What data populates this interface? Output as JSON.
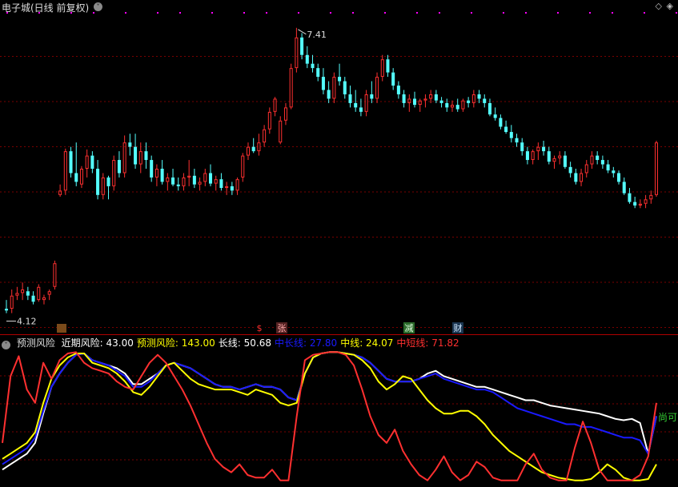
{
  "title": {
    "stock": "电子城(日线 前复权)"
  },
  "colors": {
    "bg": "#000000",
    "up": "#ff3030",
    "down": "#54ffff",
    "grid": "#7a0000",
    "sep": "#b00000",
    "magenta": "#ff00ff"
  },
  "chart_data": [
    {
      "type": "candlestick",
      "title": "电子城(日线 前复权)",
      "high_label": "7.41",
      "low_label": "4.12",
      "markers": [
        "$",
        "张",
        "减",
        "财"
      ],
      "candles": [
        [
          4.2,
          4.3,
          4.15,
          4.18
        ],
        [
          4.2,
          4.42,
          4.15,
          4.35
        ],
        [
          4.35,
          4.45,
          4.3,
          4.38
        ],
        [
          4.38,
          4.5,
          4.3,
          4.42
        ],
        [
          4.4,
          4.45,
          4.3,
          4.35
        ],
        [
          4.35,
          4.4,
          4.25,
          4.28
        ],
        [
          4.3,
          4.48,
          4.28,
          4.45
        ],
        [
          4.3,
          4.36,
          4.25,
          4.33
        ],
        [
          4.36,
          4.42,
          4.3,
          4.4
        ],
        [
          4.45,
          4.75,
          4.42,
          4.72
        ],
        [
          5.5,
          5.62,
          5.48,
          5.55
        ],
        [
          5.55,
          6.03,
          5.5,
          6.0
        ],
        [
          6.0,
          6.05,
          5.7,
          5.75
        ],
        [
          5.75,
          6.1,
          5.6,
          5.65
        ],
        [
          5.62,
          5.83,
          5.58,
          5.8
        ],
        [
          5.8,
          6.02,
          5.7,
          5.95
        ],
        [
          5.95,
          6.0,
          5.75,
          5.8
        ],
        [
          5.8,
          5.9,
          5.45,
          5.5
        ],
        [
          5.5,
          5.75,
          5.45,
          5.7
        ],
        [
          5.7,
          5.72,
          5.45,
          5.6
        ],
        [
          5.6,
          5.95,
          5.55,
          5.9
        ],
        [
          5.9,
          6.0,
          5.7,
          5.75
        ],
        [
          5.75,
          6.18,
          5.7,
          6.1
        ],
        [
          6.1,
          6.2,
          5.95,
          6.05
        ],
        [
          6.05,
          6.2,
          5.8,
          5.85
        ],
        [
          5.85,
          6.1,
          5.75,
          6.0
        ],
        [
          6.0,
          6.1,
          5.8,
          5.9
        ],
        [
          5.9,
          5.95,
          5.65,
          5.7
        ],
        [
          5.7,
          5.85,
          5.6,
          5.8
        ],
        [
          5.8,
          5.9,
          5.62,
          5.65
        ],
        [
          5.65,
          5.75,
          5.55,
          5.7
        ],
        [
          5.7,
          5.8,
          5.6,
          5.62
        ],
        [
          5.62,
          5.7,
          5.55,
          5.6
        ],
        [
          5.6,
          5.75,
          5.55,
          5.7
        ],
        [
          5.7,
          5.9,
          5.6,
          5.72
        ],
        [
          5.72,
          5.8,
          5.58,
          5.62
        ],
        [
          5.62,
          5.7,
          5.55,
          5.65
        ],
        [
          5.65,
          5.8,
          5.6,
          5.75
        ],
        [
          5.75,
          5.85,
          5.6,
          5.63
        ],
        [
          5.63,
          5.72,
          5.55,
          5.68
        ],
        [
          5.68,
          5.75,
          5.55,
          5.58
        ],
        [
          5.58,
          5.65,
          5.5,
          5.6
        ],
        [
          5.6,
          5.65,
          5.5,
          5.55
        ],
        [
          5.55,
          5.7,
          5.5,
          5.68
        ],
        [
          5.7,
          5.98,
          5.65,
          5.95
        ],
        [
          5.95,
          6.1,
          5.9,
          6.05
        ],
        [
          6.05,
          6.15,
          5.98,
          6.0
        ],
        [
          6.0,
          6.2,
          5.95,
          6.1
        ],
        [
          6.1,
          6.3,
          6.05,
          6.25
        ],
        [
          6.25,
          6.5,
          6.2,
          6.45
        ],
        [
          6.45,
          6.62,
          6.4,
          6.6
        ],
        [
          6.1,
          6.4,
          6.08,
          6.35
        ],
        [
          6.35,
          6.55,
          6.3,
          6.5
        ],
        [
          6.5,
          7.0,
          6.48,
          6.95
        ],
        [
          6.95,
          7.41,
          6.9,
          7.3
        ],
        [
          7.3,
          7.35,
          7.05,
          7.1
        ],
        [
          7.1,
          7.2,
          6.95,
          7.0
        ],
        [
          7.0,
          7.1,
          6.9,
          6.95
        ],
        [
          6.95,
          7.0,
          6.8,
          6.85
        ],
        [
          6.85,
          6.95,
          6.65,
          6.7
        ],
        [
          6.7,
          6.8,
          6.55,
          6.6
        ],
        [
          6.6,
          6.9,
          6.55,
          6.85
        ],
        [
          6.85,
          7.0,
          6.75,
          6.8
        ],
        [
          6.8,
          6.85,
          6.6,
          6.65
        ],
        [
          6.65,
          6.75,
          6.5,
          6.55
        ],
        [
          6.55,
          6.7,
          6.45,
          6.5
        ],
        [
          6.5,
          6.6,
          6.4,
          6.45
        ],
        [
          6.45,
          6.7,
          6.4,
          6.65
        ],
        [
          6.65,
          6.8,
          6.55,
          6.6
        ],
        [
          6.6,
          6.9,
          6.55,
          6.85
        ],
        [
          6.85,
          7.1,
          6.8,
          7.05
        ],
        [
          7.05,
          7.1,
          6.85,
          6.9
        ],
        [
          6.9,
          6.95,
          6.7,
          6.75
        ],
        [
          6.75,
          6.8,
          6.6,
          6.65
        ],
        [
          6.65,
          6.7,
          6.5,
          6.55
        ],
        [
          6.55,
          6.65,
          6.45,
          6.6
        ],
        [
          6.6,
          6.68,
          6.5,
          6.53
        ],
        [
          6.53,
          6.6,
          6.45,
          6.58
        ],
        [
          6.58,
          6.65,
          6.5,
          6.6
        ],
        [
          6.6,
          6.7,
          6.55,
          6.65
        ],
        [
          6.65,
          6.7,
          6.55,
          6.58
        ],
        [
          6.58,
          6.62,
          6.5,
          6.55
        ],
        [
          6.55,
          6.6,
          6.45,
          6.5
        ],
        [
          6.5,
          6.58,
          6.45,
          6.53
        ],
        [
          6.53,
          6.6,
          6.45,
          6.48
        ],
        [
          6.48,
          6.6,
          6.45,
          6.58
        ],
        [
          6.58,
          6.62,
          6.5,
          6.55
        ],
        [
          6.55,
          6.7,
          6.5,
          6.65
        ],
        [
          6.65,
          6.7,
          6.55,
          6.6
        ],
        [
          6.6,
          6.65,
          6.5,
          6.55
        ],
        [
          6.55,
          6.6,
          6.4,
          6.42
        ],
        [
          6.42,
          6.5,
          6.35,
          6.38
        ],
        [
          6.38,
          6.42,
          6.25,
          6.28
        ],
        [
          6.28,
          6.35,
          6.2,
          6.22
        ],
        [
          6.22,
          6.3,
          6.1,
          6.15
        ],
        [
          6.15,
          6.2,
          6.05,
          6.1
        ],
        [
          6.1,
          6.15,
          5.95,
          6.0
        ],
        [
          6.0,
          6.05,
          5.85,
          5.9
        ],
        [
          5.9,
          6.02,
          5.85,
          6.0
        ],
        [
          6.0,
          6.1,
          5.9,
          6.05
        ],
        [
          6.05,
          6.12,
          5.95,
          6.0
        ],
        [
          6.0,
          6.05,
          5.85,
          5.88
        ],
        [
          5.88,
          5.95,
          5.8,
          5.92
        ],
        [
          5.92,
          6.0,
          5.85,
          5.95
        ],
        [
          5.95,
          6.0,
          5.8,
          5.82
        ],
        [
          5.82,
          5.88,
          5.7,
          5.75
        ],
        [
          5.75,
          5.8,
          5.62,
          5.65
        ],
        [
          5.65,
          5.8,
          5.6,
          5.75
        ],
        [
          5.75,
          5.9,
          5.7,
          5.85
        ],
        [
          5.85,
          6.0,
          5.8,
          5.95
        ],
        [
          5.95,
          6.0,
          5.85,
          5.9
        ],
        [
          5.9,
          5.95,
          5.8,
          5.85
        ],
        [
          5.85,
          5.9,
          5.75,
          5.78
        ],
        [
          5.78,
          5.82,
          5.7,
          5.75
        ],
        [
          5.75,
          5.78,
          5.62,
          5.65
        ],
        [
          5.65,
          5.7,
          5.5,
          5.52
        ],
        [
          5.52,
          5.58,
          5.4,
          5.42
        ],
        [
          5.42,
          5.48,
          5.35,
          5.38
        ],
        [
          5.38,
          5.45,
          5.35,
          5.4
        ],
        [
          5.4,
          5.5,
          5.35,
          5.45
        ],
        [
          5.45,
          5.55,
          5.4,
          5.5
        ],
        [
          5.5,
          6.12,
          5.48,
          6.1
        ]
      ],
      "ylim": [
        4.0,
        7.6
      ]
    },
    {
      "type": "line",
      "title": "预测风险",
      "legend": [
        {
          "name": "近期风险",
          "value": "43.00",
          "color": "#ffffff"
        },
        {
          "name": "预测风险",
          "value": "143.00",
          "color": "#ffff00"
        },
        {
          "name": "长线",
          "value": "50.68",
          "color": "#ffffff"
        },
        {
          "name": "中长线",
          "value": "27.80",
          "color": "#1a1aff"
        },
        {
          "name": "中线",
          "value": "24.07",
          "color": "#ffff00"
        },
        {
          "name": "中短线",
          "value": "71.82",
          "color": "#ff3030"
        }
      ],
      "annotation": "尚可",
      "ylim": [
        0,
        100
      ],
      "series": [
        {
          "name": "长线",
          "color": "#ffffff",
          "values": [
            10,
            14,
            18,
            22,
            30,
            52,
            72,
            82,
            90,
            96,
            97,
            92,
            90,
            88,
            86,
            82,
            74,
            74,
            78,
            82,
            88,
            90,
            88,
            86,
            82,
            78,
            74,
            72,
            72,
            70,
            72,
            74,
            72,
            72,
            70,
            64,
            62,
            82,
            94,
            97,
            98,
            98,
            97,
            96,
            94,
            90,
            84,
            78,
            76,
            76,
            76,
            78,
            82,
            84,
            80,
            78,
            76,
            74,
            72,
            72,
            70,
            68,
            66,
            64,
            62,
            62,
            60,
            58,
            57,
            56,
            55,
            54,
            53,
            52,
            50,
            48,
            47,
            48,
            45,
            22,
            50
          ]
        },
        {
          "name": "中长线",
          "color": "#1a1aff",
          "values": [
            14,
            18,
            22,
            26,
            34,
            54,
            72,
            82,
            90,
            96,
            97,
            92,
            90,
            88,
            84,
            80,
            72,
            72,
            76,
            82,
            88,
            90,
            88,
            86,
            82,
            78,
            74,
            72,
            72,
            70,
            72,
            74,
            72,
            72,
            70,
            64,
            62,
            82,
            94,
            97,
            98,
            98,
            97,
            96,
            94,
            90,
            84,
            78,
            76,
            76,
            76,
            78,
            80,
            82,
            78,
            76,
            74,
            72,
            70,
            70,
            68,
            64,
            60,
            56,
            54,
            52,
            50,
            48,
            46,
            44,
            44,
            42,
            42,
            40,
            38,
            36,
            34,
            34,
            32,
            22,
            50
          ]
        },
        {
          "name": "中线",
          "color": "#ffff00",
          "values": [
            18,
            22,
            26,
            30,
            38,
            60,
            78,
            88,
            94,
            97,
            97,
            90,
            88,
            86,
            82,
            76,
            68,
            66,
            72,
            80,
            88,
            90,
            84,
            78,
            74,
            72,
            70,
            70,
            70,
            68,
            66,
            70,
            68,
            66,
            60,
            58,
            60,
            82,
            94,
            97,
            98,
            98,
            97,
            96,
            92,
            86,
            76,
            70,
            74,
            80,
            78,
            70,
            62,
            56,
            52,
            52,
            54,
            54,
            50,
            44,
            36,
            30,
            24,
            20,
            16,
            12,
            8,
            6,
            4,
            3,
            2,
            2,
            3,
            8,
            14,
            10,
            4,
            2,
            2,
            3,
            14
          ]
        },
        {
          "name": "中短线",
          "color": "#ff3030",
          "values": [
            30,
            80,
            95,
            70,
            60,
            90,
            78,
            92,
            97,
            98,
            90,
            86,
            84,
            82,
            76,
            72,
            70,
            80,
            90,
            96,
            90,
            80,
            70,
            58,
            44,
            30,
            18,
            12,
            8,
            14,
            6,
            4,
            4,
            10,
            2,
            2,
            50,
            92,
            96,
            97,
            98,
            98,
            96,
            88,
            70,
            50,
            36,
            30,
            40,
            24,
            14,
            6,
            2,
            10,
            20,
            8,
            2,
            6,
            16,
            12,
            4,
            2,
            2,
            2,
            14,
            22,
            10,
            4,
            2,
            2,
            26,
            46,
            30,
            10,
            2,
            2,
            2,
            2,
            6,
            20,
            60
          ]
        }
      ]
    }
  ]
}
